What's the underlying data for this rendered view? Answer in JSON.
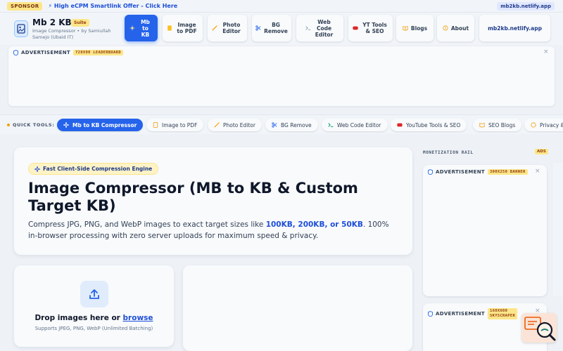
{
  "sponsor": {
    "tag": "SPONSOR",
    "link": "⚡ High eCPM Smartlink Offer - Click Here",
    "domain": "mb2kb.netlify.app"
  },
  "brand": {
    "title": "Mb 2 KB",
    "badge": "Suite",
    "subtitle": "Image Compressor • by Samiullah Samejo (Ubaid IT)"
  },
  "nav": {
    "items": [
      {
        "label": "Mb to KB",
        "active": true
      },
      {
        "label": "Image to PDF"
      },
      {
        "label": "Photo Editor"
      },
      {
        "label": "BG Remove"
      },
      {
        "label": "Web Code Editor"
      },
      {
        "label": "YT Tools & SEO"
      },
      {
        "label": "Blogs"
      },
      {
        "label": "About"
      },
      {
        "label": "mb2kb.netlify.app"
      }
    ]
  },
  "ad_top": {
    "label": "ADVERTISEMENT",
    "size": "728X90 LEADERBOARD",
    "close": "×"
  },
  "quick_tools": {
    "label": "QUICK TOOLS:",
    "items": [
      {
        "label": "Mb to KB Compressor",
        "active": true
      },
      {
        "label": "Image to PDF"
      },
      {
        "label": "Photo Editor"
      },
      {
        "label": "BG Remove"
      },
      {
        "label": "Web Code Editor"
      },
      {
        "label": "YouTube Tools & SEO"
      },
      {
        "label": "SEO Blogs"
      },
      {
        "label": "Privacy &"
      }
    ]
  },
  "hero": {
    "badge": "Fast Client-Side Compression Engine",
    "title": "Image Compressor (MB to KB & Custom Target KB)",
    "desc_before": "Compress JPG, PNG, and WebP images to exact target sizes like ",
    "desc_highlight": "100KB, 200KB, or 50KB",
    "desc_after": ". 100% in-browser processing with zero server uploads for maximum speed & privacy."
  },
  "dropzone": {
    "title": "Drop images here or",
    "browse": "browse",
    "subtitle": "Supports JPEG, PNG, WebP (Unlimited Batching)"
  },
  "rail": {
    "label": "MONETIZATION RAIL",
    "ads_badge": "ADS",
    "ad1": {
      "label": "ADVERTISEMENT",
      "size": "300X250 BANNER",
      "close": "×"
    },
    "ad2": {
      "label": "ADVERTISEMENT",
      "size_line1": "160X600",
      "size_line2": "SKYSCRAPER",
      "close": "×"
    }
  },
  "colors": {
    "accent": "#2563eb",
    "badge": "#fde68a",
    "background": "#eef2f7"
  }
}
